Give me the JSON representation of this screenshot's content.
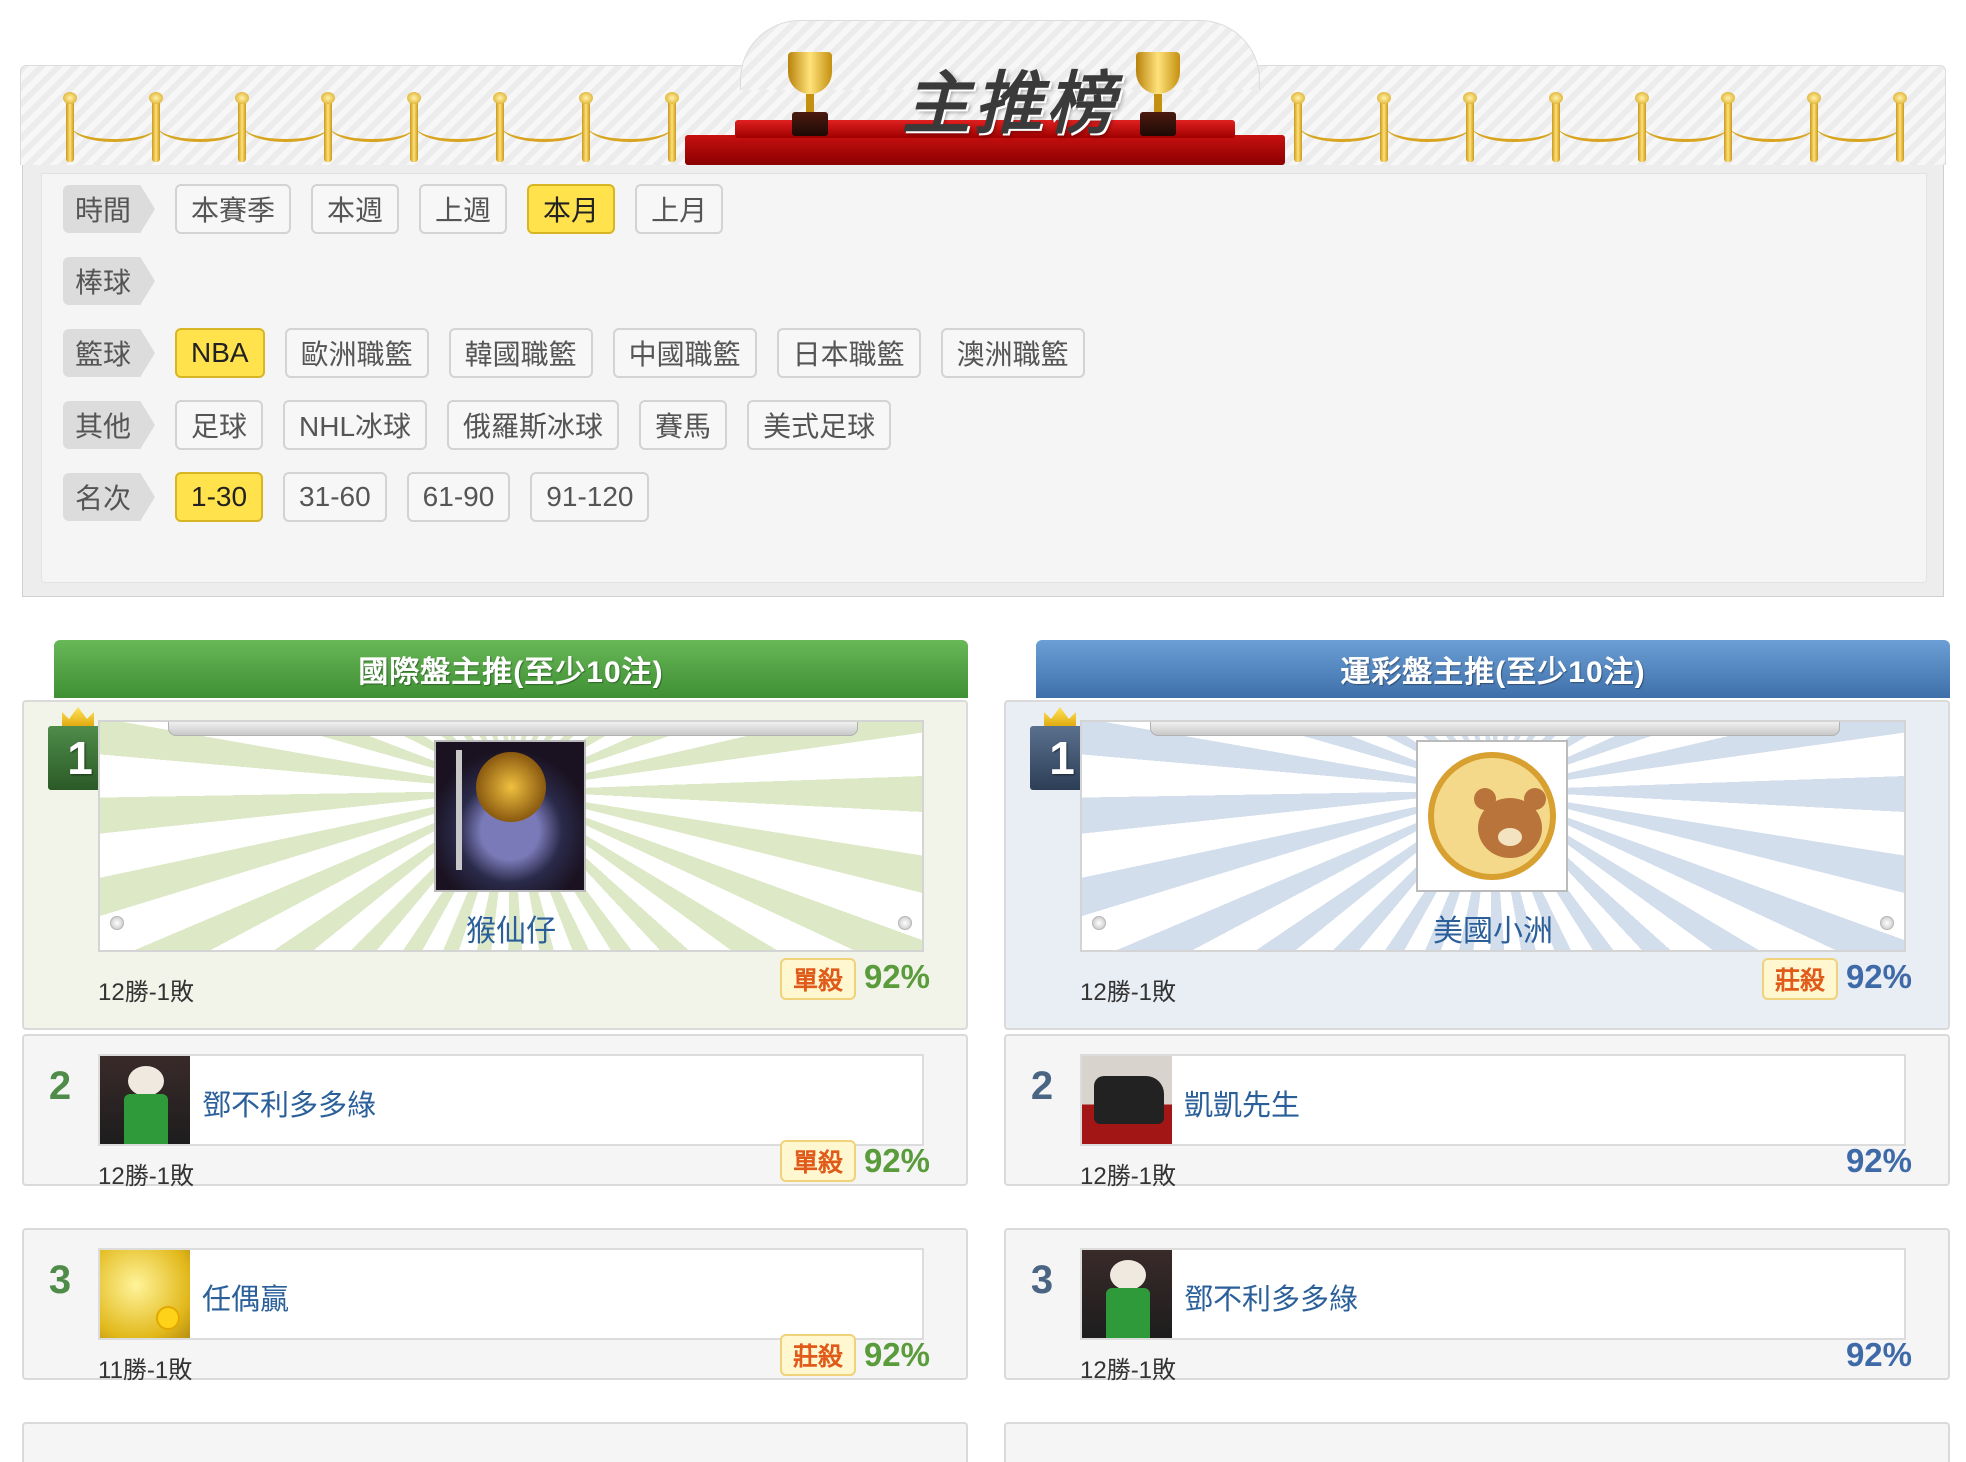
{
  "banner": {
    "title": "主推榜"
  },
  "filters": [
    {
      "label": "時間",
      "options": [
        {
          "text": "本賽季",
          "active": false
        },
        {
          "text": "本週",
          "active": false
        },
        {
          "text": "上週",
          "active": false
        },
        {
          "text": "本月",
          "active": true
        },
        {
          "text": "上月",
          "active": false
        }
      ]
    },
    {
      "label": "棒球",
      "options": []
    },
    {
      "label": "籃球",
      "options": [
        {
          "text": "NBA",
          "active": true
        },
        {
          "text": "歐洲職籃",
          "active": false
        },
        {
          "text": "韓國職籃",
          "active": false
        },
        {
          "text": "中國職籃",
          "active": false
        },
        {
          "text": "日本職籃",
          "active": false
        },
        {
          "text": "澳洲職籃",
          "active": false
        }
      ]
    },
    {
      "label": "其他",
      "options": [
        {
          "text": "足球",
          "active": false
        },
        {
          "text": "NHL冰球",
          "active": false
        },
        {
          "text": "俄羅斯冰球",
          "active": false
        },
        {
          "text": "賽馬",
          "active": false
        },
        {
          "text": "美式足球",
          "active": false
        }
      ]
    },
    {
      "label": "名次",
      "options": [
        {
          "text": "1-30",
          "active": true
        },
        {
          "text": "31-60",
          "active": false
        },
        {
          "text": "61-90",
          "active": false
        },
        {
          "text": "91-120",
          "active": false
        }
      ]
    }
  ],
  "left": {
    "header": "國際盤主推(至少10注)",
    "entries": [
      {
        "rank": "1",
        "name": "猴仙仔",
        "record": "12勝-1敗",
        "tag": "單殺",
        "pct": "92%"
      },
      {
        "rank": "2",
        "name": "鄧不利多多綠",
        "record": "12勝-1敗",
        "tag": "單殺",
        "pct": "92%"
      },
      {
        "rank": "3",
        "name": "任偶贏",
        "record": "11勝-1敗",
        "tag": "莊殺",
        "pct": "92%"
      }
    ]
  },
  "right": {
    "header": "運彩盤主推(至少10注)",
    "entries": [
      {
        "rank": "1",
        "name": "美國小洲",
        "record": "12勝-1敗",
        "tag": "莊殺",
        "pct": "92%"
      },
      {
        "rank": "2",
        "name": "凱凱先生",
        "record": "12勝-1敗",
        "tag": "",
        "pct": "92%"
      },
      {
        "rank": "3",
        "name": "鄧不利多多綠",
        "record": "12勝-1敗",
        "tag": "",
        "pct": "92%"
      }
    ]
  },
  "colors": {
    "active_chip": "#ffe24c",
    "left_accent": "#4f8c4a",
    "right_accent": "#3e6fa9",
    "name_link": "#2a5f9a"
  }
}
